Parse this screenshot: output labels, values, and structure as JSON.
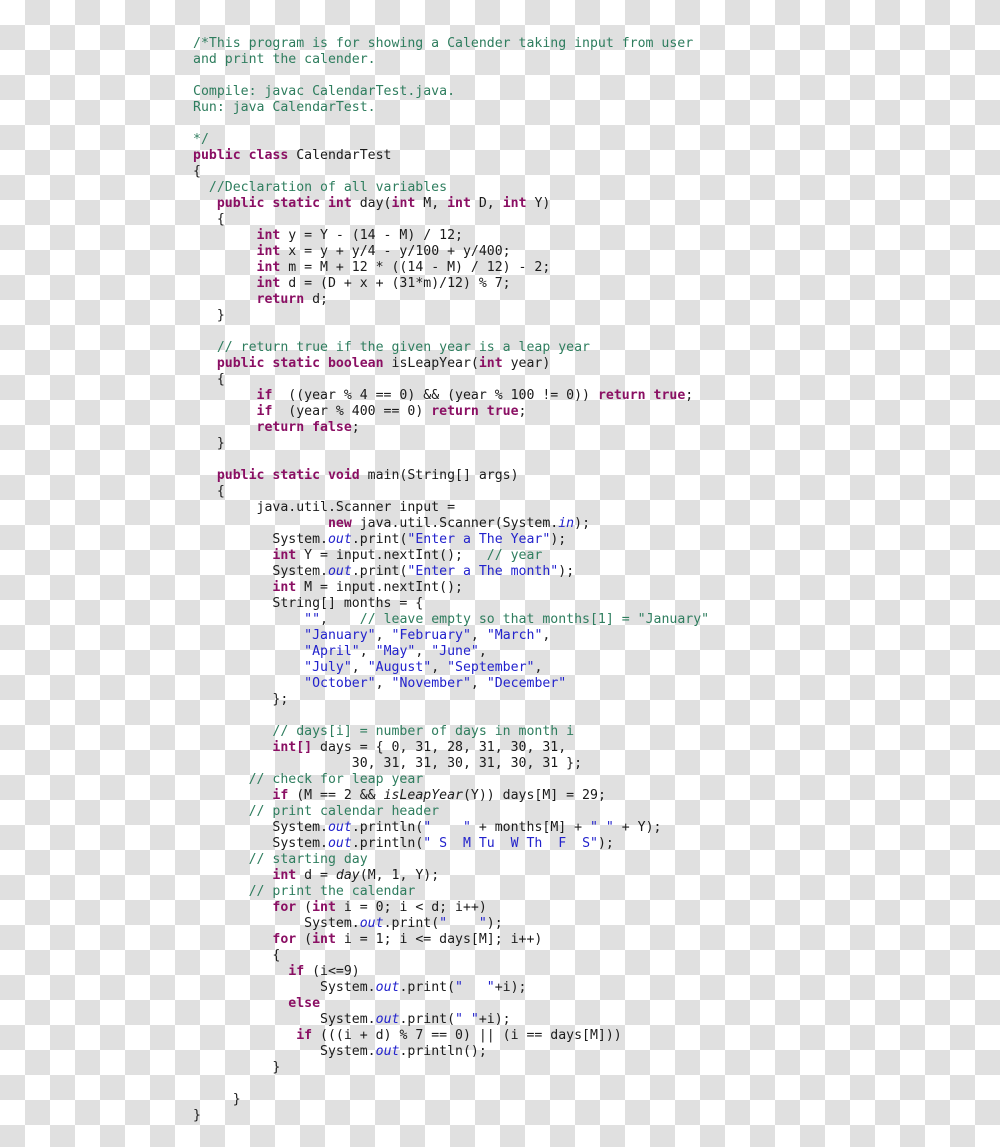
{
  "document": {
    "kind": "source-code-listing",
    "language": "Java",
    "class_name": "CalendarTest",
    "file_name": "CalendarTest.java",
    "background": "transparency-checkerboard",
    "colors": {
      "comment": "#2e7d5e",
      "keyword": "#8a0f63",
      "string": "#2222cc",
      "field": "#2222cc",
      "plain": "#1a1a1a",
      "checker_light": "#ffffff",
      "checker_dark": "#e0e0e0"
    }
  },
  "code": {
    "lines": [
      [
        {
          "t": "cm",
          "s": "/*This program is for showing a Calender taking input from user"
        }
      ],
      [
        {
          "t": "cm",
          "s": "and print the calender."
        }
      ],
      [
        {
          "t": "cm",
          "s": ""
        }
      ],
      [
        {
          "t": "cm",
          "s": "Compile: javac CalendarTest.java."
        }
      ],
      [
        {
          "t": "cm",
          "s": "Run: java CalendarTest."
        }
      ],
      [
        {
          "t": "cm",
          "s": ""
        }
      ],
      [
        {
          "t": "cm",
          "s": "*/"
        }
      ],
      [
        {
          "t": "kw",
          "s": "public class "
        },
        {
          "t": "pl",
          "s": "CalendarTest"
        }
      ],
      [
        {
          "t": "pl",
          "s": "{"
        }
      ],
      [
        {
          "t": "cm",
          "s": "  //Declaration of all variables"
        }
      ],
      [
        {
          "t": "kw",
          "s": "   public static int "
        },
        {
          "t": "pl",
          "s": "day("
        },
        {
          "t": "kw",
          "s": "int"
        },
        {
          "t": "pl",
          "s": " M, "
        },
        {
          "t": "kw",
          "s": "int"
        },
        {
          "t": "pl",
          "s": " D, "
        },
        {
          "t": "kw",
          "s": "int"
        },
        {
          "t": "pl",
          "s": " Y)"
        }
      ],
      [
        {
          "t": "pl",
          "s": "   {"
        }
      ],
      [
        {
          "t": "kw",
          "s": "        int "
        },
        {
          "t": "pl",
          "s": "y = Y - (14 - M) / 12;"
        }
      ],
      [
        {
          "t": "kw",
          "s": "        int "
        },
        {
          "t": "pl",
          "s": "x = y + y/4 - y/100 + y/400;"
        }
      ],
      [
        {
          "t": "kw",
          "s": "        int "
        },
        {
          "t": "pl",
          "s": "m = M + 12 * ((14 - M) / 12) - 2;"
        }
      ],
      [
        {
          "t": "kw",
          "s": "        int "
        },
        {
          "t": "pl",
          "s": "d = (D + x + (31*m)/12) % 7;"
        }
      ],
      [
        {
          "t": "kw",
          "s": "        return "
        },
        {
          "t": "pl",
          "s": "d;"
        }
      ],
      [
        {
          "t": "pl",
          "s": "   }"
        }
      ],
      [
        {
          "t": "pl",
          "s": ""
        }
      ],
      [
        {
          "t": "cm",
          "s": "   // return true if the given year is a leap year"
        }
      ],
      [
        {
          "t": "kw",
          "s": "   public static boolean "
        },
        {
          "t": "pl",
          "s": "isLeapYear("
        },
        {
          "t": "kw",
          "s": "int"
        },
        {
          "t": "pl",
          "s": " year)"
        }
      ],
      [
        {
          "t": "pl",
          "s": "   {"
        }
      ],
      [
        {
          "t": "kw",
          "s": "        if "
        },
        {
          "t": "pl",
          "s": " ((year % 4 == 0) && (year % 100 != 0)) "
        },
        {
          "t": "kw",
          "s": "return true"
        },
        {
          "t": "pl",
          "s": ";"
        }
      ],
      [
        {
          "t": "kw",
          "s": "        if "
        },
        {
          "t": "pl",
          "s": " (year % 400 == 0) "
        },
        {
          "t": "kw",
          "s": "return true"
        },
        {
          "t": "pl",
          "s": ";"
        }
      ],
      [
        {
          "t": "kw",
          "s": "        return false"
        },
        {
          "t": "pl",
          "s": ";"
        }
      ],
      [
        {
          "t": "pl",
          "s": "   }"
        }
      ],
      [
        {
          "t": "pl",
          "s": ""
        }
      ],
      [
        {
          "t": "kw",
          "s": "   public static void "
        },
        {
          "t": "pl",
          "s": "main(String[] args)"
        }
      ],
      [
        {
          "t": "pl",
          "s": "   {"
        }
      ],
      [
        {
          "t": "pl",
          "s": "        java.util.Scanner input ="
        }
      ],
      [
        {
          "t": "kw",
          "s": "                 new "
        },
        {
          "t": "pl",
          "s": "java.util.Scanner(System."
        },
        {
          "t": "fld",
          "s": "in"
        },
        {
          "t": "pl",
          "s": ");"
        }
      ],
      [
        {
          "t": "pl",
          "s": "          System."
        },
        {
          "t": "fld",
          "s": "out"
        },
        {
          "t": "pl",
          "s": ".print("
        },
        {
          "t": "st",
          "s": "\"Enter a The Year\""
        },
        {
          "t": "pl",
          "s": ");"
        }
      ],
      [
        {
          "t": "kw",
          "s": "          int "
        },
        {
          "t": "pl",
          "s": "Y = input.nextInt();   "
        },
        {
          "t": "cm",
          "s": "// year"
        }
      ],
      [
        {
          "t": "pl",
          "s": "          System."
        },
        {
          "t": "fld",
          "s": "out"
        },
        {
          "t": "pl",
          "s": ".print("
        },
        {
          "t": "st",
          "s": "\"Enter a The month\""
        },
        {
          "t": "pl",
          "s": ");"
        }
      ],
      [
        {
          "t": "kw",
          "s": "          int "
        },
        {
          "t": "pl",
          "s": "M = input.nextInt();"
        }
      ],
      [
        {
          "t": "pl",
          "s": "          String[] months = {"
        }
      ],
      [
        {
          "t": "st",
          "s": "              \"\""
        },
        {
          "t": "pl",
          "s": ",    "
        },
        {
          "t": "cm",
          "s": "// leave empty so that months[1] = \"January\""
        }
      ],
      [
        {
          "t": "st",
          "s": "              \"January\""
        },
        {
          "t": "pl",
          "s": ", "
        },
        {
          "t": "st",
          "s": "\"February\""
        },
        {
          "t": "pl",
          "s": ", "
        },
        {
          "t": "st",
          "s": "\"March\""
        },
        {
          "t": "pl",
          "s": ","
        }
      ],
      [
        {
          "t": "st",
          "s": "              \"April\""
        },
        {
          "t": "pl",
          "s": ", "
        },
        {
          "t": "st",
          "s": "\"May\""
        },
        {
          "t": "pl",
          "s": ", "
        },
        {
          "t": "st",
          "s": "\"June\""
        },
        {
          "t": "pl",
          "s": ","
        }
      ],
      [
        {
          "t": "st",
          "s": "              \"July\""
        },
        {
          "t": "pl",
          "s": ", "
        },
        {
          "t": "st",
          "s": "\"August\""
        },
        {
          "t": "pl",
          "s": ", "
        },
        {
          "t": "st",
          "s": "\"September\""
        },
        {
          "t": "pl",
          "s": ","
        }
      ],
      [
        {
          "t": "st",
          "s": "              \"October\""
        },
        {
          "t": "pl",
          "s": ", "
        },
        {
          "t": "st",
          "s": "\"November\""
        },
        {
          "t": "pl",
          "s": ", "
        },
        {
          "t": "st",
          "s": "\"December\""
        }
      ],
      [
        {
          "t": "pl",
          "s": "          };"
        }
      ],
      [
        {
          "t": "pl",
          "s": ""
        }
      ],
      [
        {
          "t": "cm",
          "s": "          // days[i] = number of days in month i"
        }
      ],
      [
        {
          "t": "kw",
          "s": "          int[] "
        },
        {
          "t": "pl",
          "s": "days = { 0, 31, 28, 31, 30, 31,"
        }
      ],
      [
        {
          "t": "pl",
          "s": "                    30, 31, 31, 30, 31, 30, 31 };"
        }
      ],
      [
        {
          "t": "cm",
          "s": "       // check for leap year"
        }
      ],
      [
        {
          "t": "kw",
          "s": "          if "
        },
        {
          "t": "pl",
          "s": "(M == 2 && "
        },
        {
          "t": "mth",
          "s": "isLeapYear"
        },
        {
          "t": "pl",
          "s": "(Y)) days[M] = 29;"
        }
      ],
      [
        {
          "t": "cm",
          "s": "       // print calendar header"
        }
      ],
      [
        {
          "t": "pl",
          "s": "          System."
        },
        {
          "t": "fld",
          "s": "out"
        },
        {
          "t": "pl",
          "s": ".println("
        },
        {
          "t": "st",
          "s": "\"    \""
        },
        {
          "t": "pl",
          "s": " + months[M] + "
        },
        {
          "t": "st",
          "s": "\" \""
        },
        {
          "t": "pl",
          "s": " + Y);"
        }
      ],
      [
        {
          "t": "pl",
          "s": "          System."
        },
        {
          "t": "fld",
          "s": "out"
        },
        {
          "t": "pl",
          "s": ".println("
        },
        {
          "t": "st",
          "s": "\" S  M Tu  W Th  F  S\""
        },
        {
          "t": "pl",
          "s": ");"
        }
      ],
      [
        {
          "t": "cm",
          "s": "       // starting day"
        }
      ],
      [
        {
          "t": "kw",
          "s": "          int "
        },
        {
          "t": "pl",
          "s": "d = "
        },
        {
          "t": "mth",
          "s": "day"
        },
        {
          "t": "pl",
          "s": "(M, 1, Y);"
        }
      ],
      [
        {
          "t": "cm",
          "s": "       // print the calendar"
        }
      ],
      [
        {
          "t": "kw",
          "s": "          for "
        },
        {
          "t": "pl",
          "s": "("
        },
        {
          "t": "kw",
          "s": "int"
        },
        {
          "t": "pl",
          "s": " i = 0; i < d; i++)"
        }
      ],
      [
        {
          "t": "pl",
          "s": "              System."
        },
        {
          "t": "fld",
          "s": "out"
        },
        {
          "t": "pl",
          "s": ".print("
        },
        {
          "t": "st",
          "s": "\"    \""
        },
        {
          "t": "pl",
          "s": ");"
        }
      ],
      [
        {
          "t": "kw",
          "s": "          for "
        },
        {
          "t": "pl",
          "s": "("
        },
        {
          "t": "kw",
          "s": "int"
        },
        {
          "t": "pl",
          "s": " i = 1; i <= days[M]; i++)"
        }
      ],
      [
        {
          "t": "pl",
          "s": "          {"
        }
      ],
      [
        {
          "t": "kw",
          "s": "            if "
        },
        {
          "t": "pl",
          "s": "(i<=9)"
        }
      ],
      [
        {
          "t": "pl",
          "s": "                System."
        },
        {
          "t": "fld",
          "s": "out"
        },
        {
          "t": "pl",
          "s": ".print("
        },
        {
          "t": "st",
          "s": "\"   \""
        },
        {
          "t": "pl",
          "s": "+i);"
        }
      ],
      [
        {
          "t": "kw",
          "s": "            else"
        }
      ],
      [
        {
          "t": "pl",
          "s": "                System."
        },
        {
          "t": "fld",
          "s": "out"
        },
        {
          "t": "pl",
          "s": ".print("
        },
        {
          "t": "st",
          "s": "\" \""
        },
        {
          "t": "pl",
          "s": "+i);"
        }
      ],
      [
        {
          "t": "kw",
          "s": "             if "
        },
        {
          "t": "pl",
          "s": "(((i + d) % 7 == 0) || (i == days[M]))"
        }
      ],
      [
        {
          "t": "pl",
          "s": "                System."
        },
        {
          "t": "fld",
          "s": "out"
        },
        {
          "t": "pl",
          "s": ".println();"
        }
      ],
      [
        {
          "t": "pl",
          "s": "          }"
        }
      ],
      [
        {
          "t": "pl",
          "s": ""
        }
      ],
      [
        {
          "t": "pl",
          "s": "     }"
        }
      ],
      [
        {
          "t": "pl",
          "s": "}"
        }
      ]
    ]
  }
}
